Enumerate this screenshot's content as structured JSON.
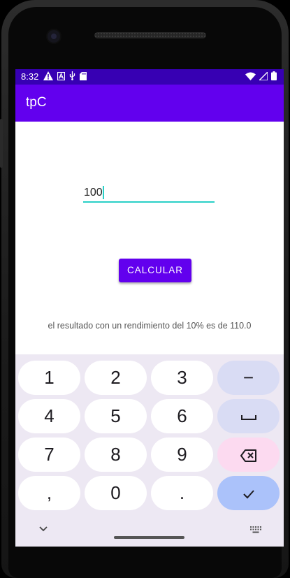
{
  "status_bar": {
    "time": "8:32",
    "left_icons": [
      "warning-icon",
      "a-box-icon",
      "usb-icon",
      "sd-card-icon"
    ],
    "right_icons": [
      "wifi-icon",
      "signal-icon",
      "battery-icon"
    ]
  },
  "app": {
    "title": "tpC"
  },
  "main": {
    "amount_value": "100",
    "calc_button": "CALCULAR",
    "result_text": "el resultado con un rendimiento del 10% es de 110.0"
  },
  "keyboard": {
    "keys": [
      {
        "label": "1"
      },
      {
        "label": "2"
      },
      {
        "label": "3"
      },
      {
        "label": "−"
      },
      {
        "label": "4"
      },
      {
        "label": "5"
      },
      {
        "label": "6"
      },
      {
        "label": "space-icon"
      },
      {
        "label": "7"
      },
      {
        "label": "8"
      },
      {
        "label": "9"
      },
      {
        "label": "backspace-icon"
      },
      {
        "label": ","
      },
      {
        "label": "0"
      },
      {
        "label": "."
      },
      {
        "label": "check-icon"
      }
    ],
    "bottom_left_icon": "chevron-down-icon",
    "bottom_right_icon": "keyboard-icon"
  },
  "colors": {
    "status_bar": "#3700b3",
    "app_bar": "#6200ee",
    "accent": "#2ad0c7",
    "keyboard_bg": "#ede8f3"
  }
}
